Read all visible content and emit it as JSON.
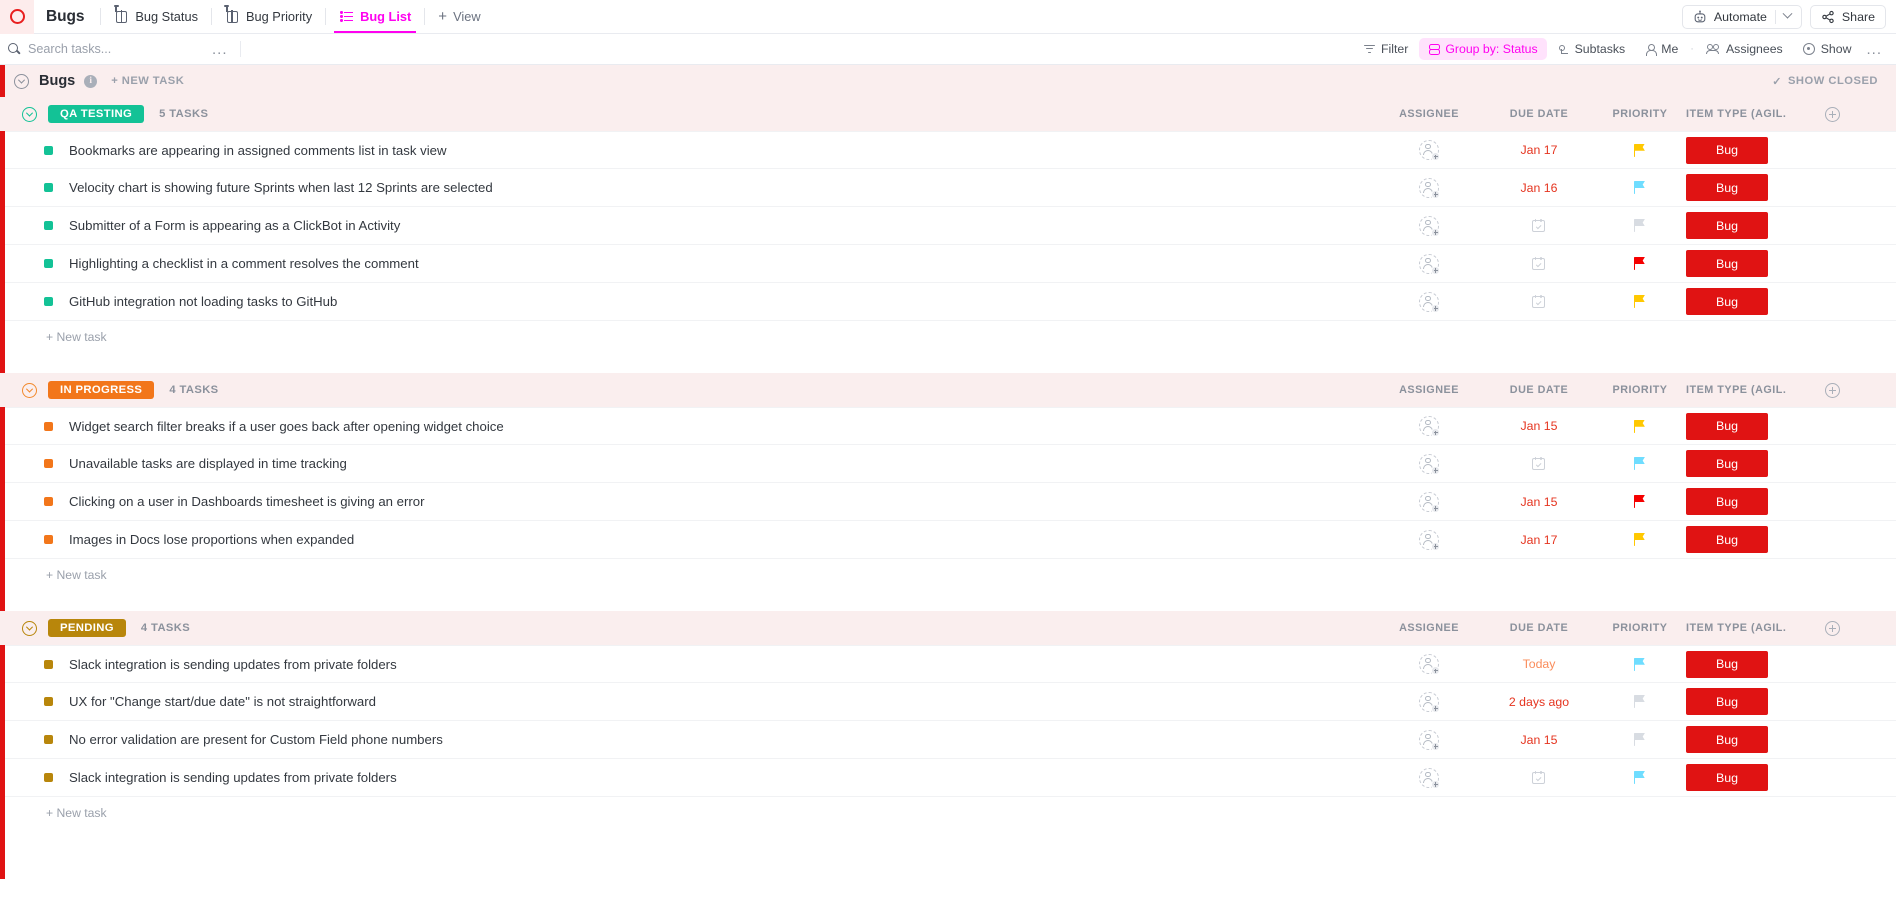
{
  "nav": {
    "logo": "clickup-logo-icon",
    "workspace_title": "Bugs",
    "tabs": [
      {
        "label": "Bug Status",
        "icon": "board-pin-icon",
        "active": false
      },
      {
        "label": "Bug Priority",
        "icon": "board-pin-icon",
        "active": false
      },
      {
        "label": "Bug List",
        "icon": "list-icon",
        "active": true
      }
    ],
    "add_view_label": "View",
    "automate_label": "Automate",
    "share_label": "Share"
  },
  "toolbar": {
    "search_placeholder": "Search tasks...",
    "search_value": "",
    "more_label": "...",
    "items": [
      {
        "label": "Filter",
        "icon": "funnel-icon",
        "active": false
      },
      {
        "label": "Group by: Status",
        "icon": "group-icon",
        "active": true
      },
      {
        "label": "Subtasks",
        "icon": "subtask-icon",
        "active": false
      },
      {
        "label": "Me",
        "icon": "person-icon",
        "active": false
      },
      {
        "label": "Assignees",
        "icon": "people-icon",
        "active": false
      },
      {
        "label": "Show",
        "icon": "eye-icon",
        "active": false
      }
    ],
    "overflow_label": "..."
  },
  "list": {
    "title": "Bugs",
    "info_char": "i",
    "new_task_label": "+ NEW TASK",
    "show_closed_label": "SHOW CLOSED",
    "accent_color": "#e01313",
    "header_bg": "#faeeee"
  },
  "columns": {
    "assignee": "ASSIGNEE",
    "due_date": "DUE DATE",
    "priority": "PRIORITY",
    "item_type": "ITEM TYPE (AGIL...",
    "add_column": "+"
  },
  "add_task_label": "+ New task",
  "item_type_value": "Bug",
  "item_type_color": "#e01313",
  "groups": [
    {
      "status": "QA TESTING",
      "status_color": "#13c296",
      "count_label": "5 TASKS",
      "tasks": [
        {
          "name": "Bookmarks are appearing in assigned comments list in task view",
          "due": "Jan 17",
          "due_color": "#e5341f",
          "has_due": true,
          "priority": "yellow",
          "priority_color": "#ffc800"
        },
        {
          "name": "Velocity chart is showing future Sprints when last 12 Sprints are selected",
          "due": "Jan 16",
          "due_color": "#e5341f",
          "has_due": true,
          "priority": "blue",
          "priority_color": "#6fddff"
        },
        {
          "name": "Submitter of a Form is appearing as a ClickBot in Activity",
          "due": "",
          "due_color": "",
          "has_due": false,
          "priority": "gray",
          "priority_color": "#d8dce2"
        },
        {
          "name": "Highlighting a checklist in a comment resolves the comment",
          "due": "",
          "due_color": "",
          "has_due": false,
          "priority": "red",
          "priority_color": "#f50000"
        },
        {
          "name": "GitHub integration not loading tasks to GitHub",
          "due": "",
          "due_color": "",
          "has_due": false,
          "priority": "yellow",
          "priority_color": "#ffc800"
        }
      ]
    },
    {
      "status": "IN PROGRESS",
      "status_color": "#f2761a",
      "count_label": "4 TASKS",
      "tasks": [
        {
          "name": "Widget search filter breaks if a user goes back after opening widget choice",
          "due": "Jan 15",
          "due_color": "#e5341f",
          "has_due": true,
          "priority": "yellow",
          "priority_color": "#ffc800"
        },
        {
          "name": "Unavailable tasks are displayed in time tracking",
          "due": "",
          "due_color": "",
          "has_due": false,
          "priority": "blue",
          "priority_color": "#6fddff"
        },
        {
          "name": "Clicking on a user in Dashboards timesheet is giving an error",
          "due": "Jan 15",
          "due_color": "#e5341f",
          "has_due": true,
          "priority": "red",
          "priority_color": "#f50000"
        },
        {
          "name": "Images in Docs lose proportions when expanded",
          "due": "Jan 17",
          "due_color": "#e5341f",
          "has_due": true,
          "priority": "yellow",
          "priority_color": "#ffc800"
        }
      ]
    },
    {
      "status": "PENDING",
      "status_color": "#b8860b",
      "count_label": "4 TASKS",
      "tasks": [
        {
          "name": "Slack integration is sending updates from private folders",
          "due": "Today",
          "due_color": "#fa8c5a",
          "has_due": true,
          "priority": "blue",
          "priority_color": "#6fddff"
        },
        {
          "name": "UX for \"Change start/due date\" is not straightforward",
          "due": "2 days ago",
          "due_color": "#e5341f",
          "has_due": true,
          "priority": "gray",
          "priority_color": "#d8dce2"
        },
        {
          "name": "No error validation are present for Custom Field phone numbers",
          "due": "Jan 15",
          "due_color": "#e5341f",
          "has_due": true,
          "priority": "gray",
          "priority_color": "#d8dce2"
        },
        {
          "name": "Slack integration is sending updates from private folders",
          "due": "",
          "due_color": "",
          "has_due": false,
          "priority": "blue",
          "priority_color": "#6fddff"
        }
      ]
    }
  ]
}
